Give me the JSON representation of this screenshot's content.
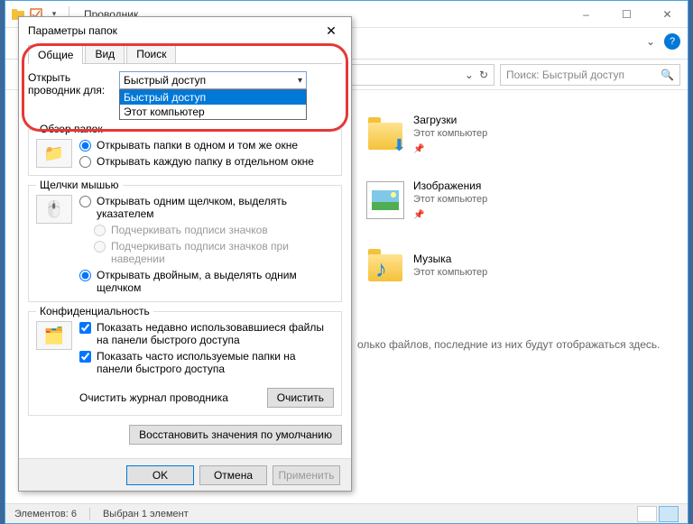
{
  "window": {
    "title": "Проводник",
    "min": "–",
    "max": "☐",
    "close": "✕"
  },
  "ribbon": {
    "expand": "⌄",
    "help": "?"
  },
  "nav": {
    "search_placeholder": "Поиск: Быстрый доступ",
    "refresh": "↻",
    "dropdown": "⌄"
  },
  "items": [
    {
      "name": "Загрузки",
      "sub": "Этот компьютер",
      "icon": "downloads"
    },
    {
      "name": "Изображения",
      "sub": "Этот компьютер",
      "icon": "pictures"
    },
    {
      "name": "Музыка",
      "sub": "Этот компьютер",
      "icon": "music"
    }
  ],
  "hint": "олько файлов, последние из них будут отображаться здесь.",
  "status": {
    "count": "Элементов: 6",
    "selection": "Выбран 1 элемент"
  },
  "dialog": {
    "title": "Параметры папок",
    "close": "✕",
    "tabs": [
      "Общие",
      "Вид",
      "Поиск"
    ],
    "open_for_label": "Открыть проводник для:",
    "combo_value": "Быстрый доступ",
    "combo_options": [
      "Быстрый доступ",
      "Этот компьютер"
    ],
    "browse": {
      "legend": "Обзор папок",
      "r1": "Открывать папки в одном и том же окне",
      "r2": "Открывать каждую папку в отдельном окне"
    },
    "click": {
      "legend": "Щелчки мышью",
      "r1": "Открывать одним щелчком, выделять указателем",
      "r1a": "Подчеркивать подписи значков",
      "r1b": "Подчеркивать подписи значков при наведении",
      "r2": "Открывать двойным, а выделять одним щелчком"
    },
    "privacy": {
      "legend": "Конфиденциальность",
      "c1": "Показать недавно использовавшиеся файлы на панели быстрого доступа",
      "c2": "Показать часто используемые папки на панели быстрого доступа",
      "clear_label": "Очистить журнал проводника",
      "clear_btn": "Очистить"
    },
    "restore": "Восстановить значения по умолчанию",
    "ok": "OK",
    "cancel": "Отмена",
    "apply": "Применить"
  }
}
